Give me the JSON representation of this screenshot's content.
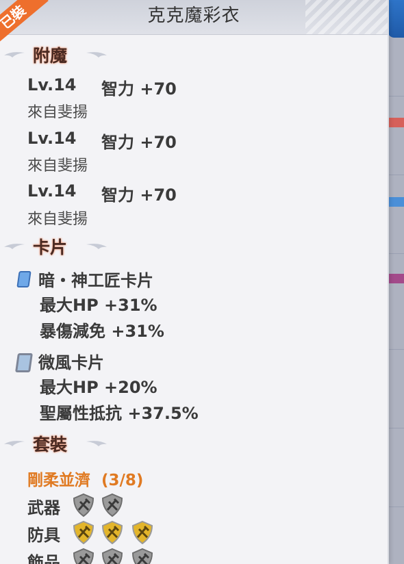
{
  "header": {
    "title": "克克魔彩衣",
    "ribbon_text": "已裝"
  },
  "sections": {
    "enchant_title": "附魔",
    "card_title": "卡片",
    "set_title": "套裝"
  },
  "enchantments": [
    {
      "level": "Lv.14",
      "effect": "智力 +70",
      "source": "來自斐揚"
    },
    {
      "level": "Lv.14",
      "effect": "智力 +70",
      "source": "來自斐揚"
    },
    {
      "level": "Lv.14",
      "effect": "智力 +70",
      "source": "來自斐揚"
    }
  ],
  "cards": [
    {
      "name": "暗・神工匠卡片",
      "icon": "blue-card-icon",
      "effects": [
        "最大HP +31%",
        "暴傷減免 +31%"
      ]
    },
    {
      "name": "微風卡片",
      "icon": "silver-card-icon",
      "effects": [
        "最大HP +20%",
        "聖屬性抵抗 +37.5%"
      ]
    }
  ],
  "set": {
    "name": "剛柔並濟  (3/8)",
    "pieces": [
      {
        "label": "武器",
        "badges": [
          "gray",
          "gray"
        ]
      },
      {
        "label": "防具",
        "badges": [
          "gold",
          "gold",
          "gold"
        ]
      },
      {
        "label": "飾品",
        "badges": [
          "gray",
          "gray",
          "gray"
        ]
      }
    ]
  },
  "colors": {
    "ribbon": "#ee6f2d",
    "section_glow": "#f3a88a",
    "set_name": "#e07a22",
    "badge_gold": "#e3b52b",
    "badge_gray": "#9a9a9a"
  }
}
